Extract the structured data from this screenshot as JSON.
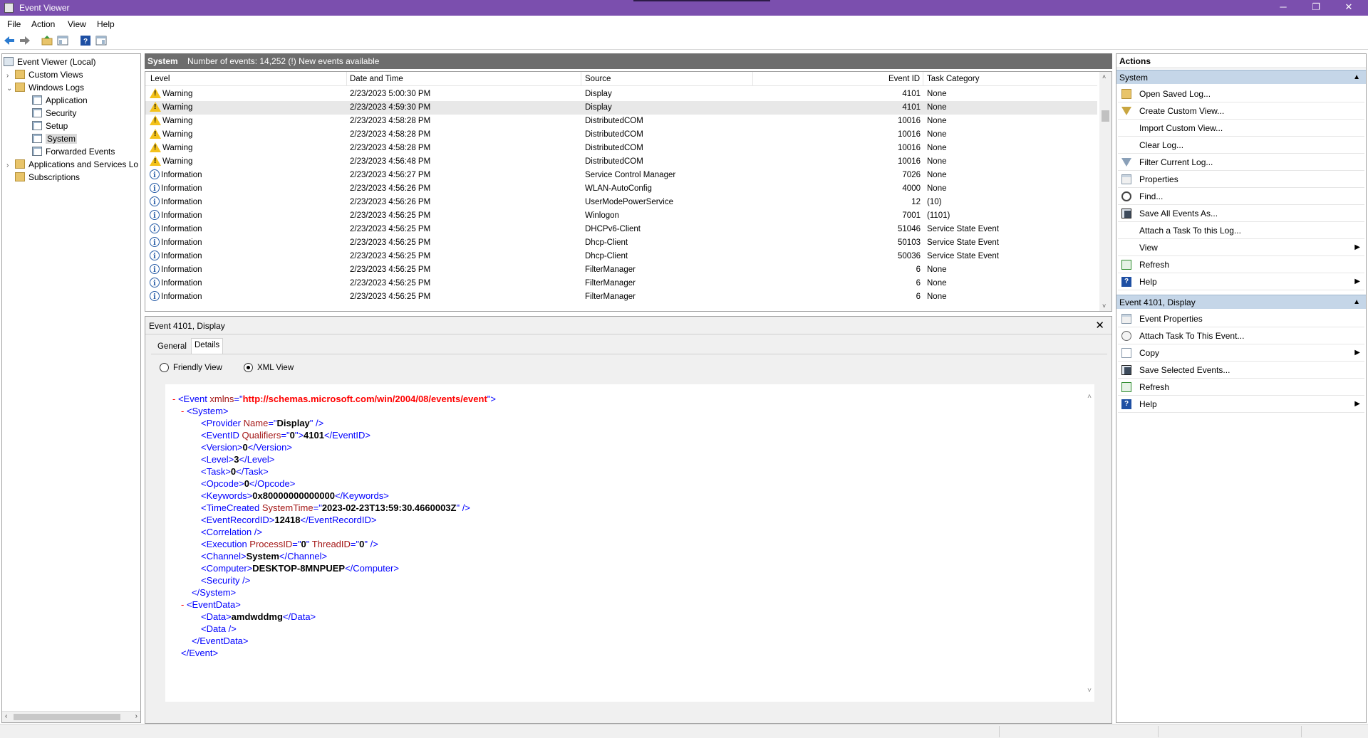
{
  "window": {
    "title": "Event Viewer",
    "minimize_glyph": "─",
    "maximize_glyph": "❐",
    "close_glyph": "✕"
  },
  "menu": [
    "File",
    "Action",
    "View",
    "Help"
  ],
  "toolbar_icons": [
    "back-arrow-icon",
    "forward-arrow-icon",
    "up-folder-icon",
    "show-hide-console-tree-icon",
    "help-icon",
    "show-hide-action-pane-icon"
  ],
  "tree": {
    "expand_glyph": "›",
    "collapse_glyph": "⌄",
    "items": [
      {
        "label": "Event Viewer (Local)"
      },
      {
        "label": "Custom Views"
      },
      {
        "label": "Windows Logs"
      },
      {
        "label": "Application"
      },
      {
        "label": "Security"
      },
      {
        "label": "Setup"
      },
      {
        "label": "System"
      },
      {
        "label": "Forwarded Events"
      },
      {
        "label": "Applications and Services Lo"
      },
      {
        "label": "Subscriptions"
      }
    ],
    "scroll_left": "‹",
    "scroll_right": "›"
  },
  "center": {
    "title": "System",
    "info": "Number of events: 14,252 (!) New events available"
  },
  "events": {
    "columns": [
      "Level",
      "Date and Time",
      "Source",
      "Event ID",
      "Task Category"
    ],
    "rows": [
      {
        "level": "Warning",
        "datetime": "2/23/2023 5:00:30 PM",
        "source": "Display",
        "event_id": "4101",
        "category": "None"
      },
      {
        "level": "Warning",
        "datetime": "2/23/2023 4:59:30 PM",
        "source": "Display",
        "event_id": "4101",
        "category": "None"
      },
      {
        "level": "Warning",
        "datetime": "2/23/2023 4:58:28 PM",
        "source": "DistributedCOM",
        "event_id": "10016",
        "category": "None"
      },
      {
        "level": "Warning",
        "datetime": "2/23/2023 4:58:28 PM",
        "source": "DistributedCOM",
        "event_id": "10016",
        "category": "None"
      },
      {
        "level": "Warning",
        "datetime": "2/23/2023 4:58:28 PM",
        "source": "DistributedCOM",
        "event_id": "10016",
        "category": "None"
      },
      {
        "level": "Warning",
        "datetime": "2/23/2023 4:56:48 PM",
        "source": "DistributedCOM",
        "event_id": "10016",
        "category": "None"
      },
      {
        "level": "Information",
        "datetime": "2/23/2023 4:56:27 PM",
        "source": "Service Control Manager",
        "event_id": "7026",
        "category": "None"
      },
      {
        "level": "Information",
        "datetime": "2/23/2023 4:56:26 PM",
        "source": "WLAN-AutoConfig",
        "event_id": "4000",
        "category": "None"
      },
      {
        "level": "Information",
        "datetime": "2/23/2023 4:56:26 PM",
        "source": "UserModePowerService",
        "event_id": "12",
        "category": "(10)"
      },
      {
        "level": "Information",
        "datetime": "2/23/2023 4:56:25 PM",
        "source": "Winlogon",
        "event_id": "7001",
        "category": "(1101)"
      },
      {
        "level": "Information",
        "datetime": "2/23/2023 4:56:25 PM",
        "source": "DHCPv6-Client",
        "event_id": "51046",
        "category": "Service State Event"
      },
      {
        "level": "Information",
        "datetime": "2/23/2023 4:56:25 PM",
        "source": "Dhcp-Client",
        "event_id": "50103",
        "category": "Service State Event"
      },
      {
        "level": "Information",
        "datetime": "2/23/2023 4:56:25 PM",
        "source": "Dhcp-Client",
        "event_id": "50036",
        "category": "Service State Event"
      },
      {
        "level": "Information",
        "datetime": "2/23/2023 4:56:25 PM",
        "source": "FilterManager",
        "event_id": "6",
        "category": "None"
      },
      {
        "level": "Information",
        "datetime": "2/23/2023 4:56:25 PM",
        "source": "FilterManager",
        "event_id": "6",
        "category": "None"
      },
      {
        "level": "Information",
        "datetime": "2/23/2023 4:56:25 PM",
        "source": "FilterManager",
        "event_id": "6",
        "category": "None"
      }
    ],
    "scroll_up": "˄",
    "scroll_down": "˅"
  },
  "detail": {
    "title": "Event 4101, Display",
    "close_glyph": "✕",
    "tabs": [
      "General",
      "Details"
    ],
    "radios": [
      "Friendly View",
      "XML View"
    ],
    "xml": {
      "collapse": "-",
      "event_open": "<Event ",
      "xmlns_attr": "xmlns",
      "eq_q": "=\"",
      "xmlns_value": "http://schemas.microsoft.com/win/2004/08/events/event",
      "q_close": "\">",
      "system_open": "<System>",
      "provider_tag": "<Provider ",
      "provider_attr": "Name",
      "provider_value": "Display",
      "provider_end": "\" />",
      "eventid_open": "<EventID ",
      "eventid_attr": "Qualifiers",
      "eventid_attr_value": "0",
      "gt_q": "\">",
      "eventid_value": "4101",
      "eventid_close": "</EventID>",
      "version_open": "<Version>",
      "version_value": "0",
      "version_close": "</Version>",
      "level_open": "<Level>",
      "level_value": "3",
      "level_close": "</Level>",
      "task_open": "<Task>",
      "task_value": "0",
      "task_close": "</Task>",
      "opcode_open": "<Opcode>",
      "opcode_value": "0",
      "opcode_close": "</Opcode>",
      "keywords_open": "<Keywords>",
      "keywords_value": "0x80000000000000",
      "keywords_close": "</Keywords>",
      "timecreated_tag": "<TimeCreated ",
      "timecreated_attr": "SystemTime",
      "timecreated_value": "2023-02-23T13:59:30.4660003Z",
      "selfclose_q": "\" />",
      "recordid_open": "<EventRecordID>",
      "recordid_value": "12418",
      "recordid_close": "</EventRecordID>",
      "correlation": "<Correlation />",
      "execution_tag": "<Execution ",
      "execution_attr1": "ProcessID",
      "execution_value1": "0",
      "execution_q_sp": "\" ",
      "execution_attr2": "ThreadID",
      "execution_value2": "0",
      "channel_open": "<Channel>",
      "channel_value": "System",
      "channel_close": "</Channel>",
      "computer_open": "<Computer>",
      "computer_value": "DESKTOP-8MNPUEP",
      "computer_close": "</Computer>",
      "security": "<Security />",
      "system_close": "</System>",
      "eventdata_open": "<EventData>",
      "data_open": "<Data>",
      "data_value": "amdwddmg",
      "data_close": "</Data>",
      "data_empty": "<Data />",
      "eventdata_close": "</EventData>",
      "event_close": "</Event>"
    }
  },
  "actions": {
    "header": "Actions",
    "section_caret": "▲",
    "submenu_glyph": "▶",
    "sections": [
      {
        "title": "System",
        "items": [
          {
            "label": "Open Saved Log...",
            "icon": "open-folder-icon"
          },
          {
            "label": "Create Custom View...",
            "icon": "filter-icon"
          },
          {
            "label": "Import Custom View...",
            "icon": ""
          },
          {
            "label": "Clear Log...",
            "icon": ""
          },
          {
            "label": "Filter Current Log...",
            "icon": "filter-icon"
          },
          {
            "label": "Properties",
            "icon": "properties-icon"
          },
          {
            "label": "Find...",
            "icon": "binoculars-icon"
          },
          {
            "label": "Save All Events As...",
            "icon": "save-icon"
          },
          {
            "label": "Attach a Task To this Log...",
            "icon": ""
          },
          {
            "label": "View",
            "icon": ""
          },
          {
            "label": "Refresh",
            "icon": "refresh-icon"
          },
          {
            "label": "Help",
            "icon": "help-icon"
          }
        ]
      },
      {
        "title": "Event 4101, Display",
        "items": [
          {
            "label": "Event Properties",
            "icon": "properties-icon"
          },
          {
            "label": "Attach Task To This Event...",
            "icon": "task-icon"
          },
          {
            "label": "Copy",
            "icon": "copy-icon"
          },
          {
            "label": "Save Selected Events...",
            "icon": "save-icon"
          },
          {
            "label": "Refresh",
            "icon": "refresh-icon"
          },
          {
            "label": "Help",
            "icon": "help-icon"
          }
        ]
      }
    ]
  }
}
